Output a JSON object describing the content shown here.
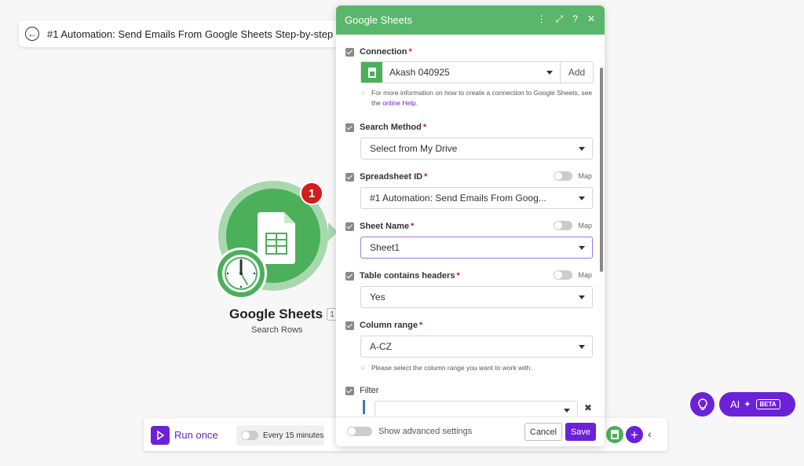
{
  "topbar": {
    "title": "#1 Automation: Send Emails From Google Sheets Step-by-step g"
  },
  "module": {
    "name": "Google Sheets",
    "id": "1",
    "subtitle": "Search Rows",
    "badge_count": "1"
  },
  "bottombar": {
    "run_label": "Run once",
    "schedule_label": "Every 15 minutes"
  },
  "ai": {
    "label": "AI",
    "beta": "BETA"
  },
  "dialog": {
    "title": "Google Sheets",
    "connection": {
      "label": "Connection",
      "value": "Akash 040925",
      "add_label": "Add",
      "hint_prefix": "For more information on how to create a connection to Google Sheets, see the ",
      "hint_link": "online Help",
      "hint_suffix": "."
    },
    "search_method": {
      "label": "Search Method",
      "value": "Select from My Drive"
    },
    "spreadsheet_id": {
      "label": "Spreadsheet ID",
      "value": "#1 Automation: Send Emails From Goog...",
      "map_label": "Map"
    },
    "sheet_name": {
      "label": "Sheet Name",
      "value": "Sheet1",
      "map_label": "Map"
    },
    "table_headers": {
      "label": "Table contains headers",
      "value": "Yes",
      "map_label": "Map"
    },
    "column_range": {
      "label": "Column range",
      "value": "A-CZ",
      "hint": "Please select the column range you want to work with."
    },
    "filter": {
      "label": "Filter"
    },
    "footer": {
      "advanced_label": "Show advanced settings",
      "cancel_label": "Cancel",
      "save_label": "Save"
    }
  },
  "colors": {
    "accent": "#6b21d8",
    "sheets_green": "#4caf5a",
    "header_green": "#5ab66a",
    "badge_red": "#d11d1d"
  }
}
